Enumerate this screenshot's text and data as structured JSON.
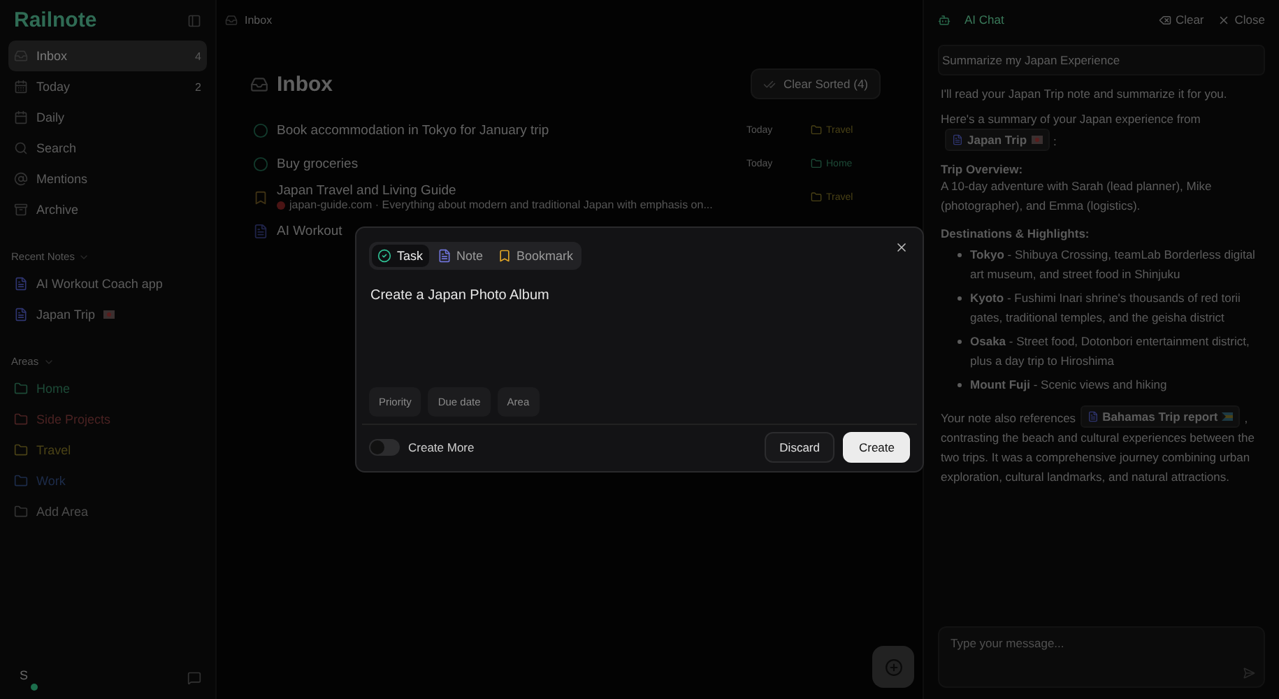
{
  "sidebar": {
    "logo": "Railnote",
    "nav": [
      {
        "kind": "inbox",
        "label": "Inbox",
        "count": "4",
        "selected": true
      },
      {
        "kind": "today",
        "label": "Today",
        "count": "2",
        "selected": false
      },
      {
        "kind": "daily",
        "label": "Daily",
        "selected": false
      },
      {
        "kind": "search",
        "label": "Search",
        "selected": false
      },
      {
        "kind": "mentions",
        "label": "Mentions",
        "selected": false
      },
      {
        "kind": "archive",
        "label": "Archive",
        "selected": false
      }
    ],
    "recent_notes": {
      "heading": "Recent Notes",
      "items": [
        {
          "label": "AI Workout Coach app",
          "kind": "plain"
        },
        {
          "label": "Japan Trip",
          "kind": "japan"
        }
      ]
    },
    "areas": {
      "heading": "Areas",
      "items": [
        {
          "label": "Home",
          "color": "#1d4a37"
        },
        {
          "label": "Side Projects",
          "color": "#4a2222"
        },
        {
          "label": "Travel",
          "color": "#4a4216"
        },
        {
          "label": "Work",
          "color": "#1d2c4a"
        }
      ],
      "add": "Add Area"
    },
    "user": {
      "initial": "S",
      "online": true
    }
  },
  "main": {
    "breadcrumb": "Inbox",
    "title": "Inbox",
    "clear_button": "Clear Sorted (4)",
    "items": [
      {
        "kind": "task",
        "title": "Book accommodation in Tokyo for January trip",
        "date": "Today",
        "area": "Travel",
        "color": "#4a4216"
      },
      {
        "kind": "task",
        "title": "Buy groceries",
        "date": "Today",
        "area": "Home",
        "color": "#1d4a37"
      },
      {
        "kind": "bookmark",
        "title": "Japan Travel and Living Guide",
        "source": "japan-guide.com",
        "excerpt": "· Everything about modern and traditional Japan with emphasis on...",
        "area": "Travel",
        "color": "#4a4216"
      },
      {
        "kind": "note",
        "title": "AI Workout"
      }
    ]
  },
  "modal": {
    "tabs": [
      {
        "kind": "task",
        "label": "Task",
        "selected": true
      },
      {
        "kind": "note",
        "label": "Note",
        "selected": false
      },
      {
        "kind": "bookmark",
        "label": "Bookmark",
        "selected": false
      }
    ],
    "value": "Create a Japan Photo Album",
    "chips": [
      "Priority",
      "Due date",
      "Area"
    ],
    "create_more": {
      "label": "Create More",
      "on": false
    },
    "discard": "Discard",
    "create": "Create"
  },
  "chat": {
    "title": "AI Chat",
    "clear": "Clear",
    "close": "Close",
    "user_message": "Summarize my Japan Experience",
    "intro": "I'll read your Japan Trip note and summarize it for you.",
    "lead": "Here's a summary of your Japan experience from",
    "lead_mention": {
      "label": "Japan Trip",
      "kind": "japan"
    },
    "lead_end": ":",
    "overview_heading": "Trip Overview:",
    "overview": "A 10-day adventure with Sarah (lead planner), Mike (photographer), and Emma (logistics).",
    "highlights_heading": "Destinations & Highlights:",
    "highlights": [
      "**Tokyo** - Shibuya Crossing, teamLab Borderless digital art museum, and street food in Shinjuku",
      "**Kyoto** - Fushimi Inari shrine's thousands of red torii gates, traditional temples, and the geisha district",
      "**Osaka** - Street food, Dotonbori entertainment district, plus a day trip to Hiroshima",
      "**Mount Fuji** - Scenic views and hiking"
    ],
    "closing": "Your note also references",
    "closing_mention": {
      "label": "Bahamas Trip report",
      "kind": "bahamas"
    },
    "closing_end": ", contrasting the beach and cultural experiences between the two trips. It was a comprehensive journey combining urban exploration, cultural landmarks, and natural attractions.",
    "placeholder": "Type your message..."
  }
}
